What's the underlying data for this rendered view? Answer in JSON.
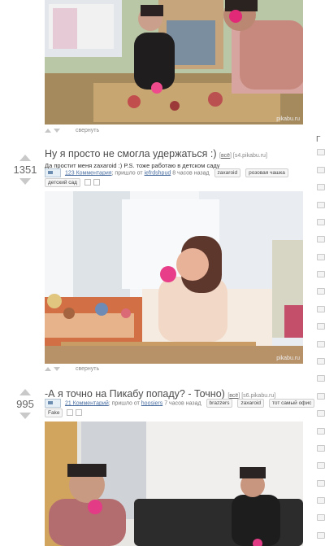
{
  "watermark": "pikabu.ru",
  "post_actions": {
    "collapse_label": "свернуть"
  },
  "sidebar_edge": {
    "letter": "Г"
  },
  "posts": [
    {
      "rating": "1351",
      "title": "Ну я просто не смогла удержаться :)",
      "source_prefix": "[",
      "source_link": "всё",
      "source_suffix": "] [s4.pikabu.ru]",
      "description": "Да простит меня zaxaroid :) P.S. тоже работаю в детском саду",
      "comments": "123 Комментария",
      "posted_prefix": "; пришло от",
      "author": "iefrdshpud",
      "time": "8 часов назад",
      "tags": [
        "zaxaroid",
        "розовая чашка",
        "детский сад"
      ]
    },
    {
      "rating": "995",
      "title": "-А я точно на Пикабу попаду? - Точно)",
      "source_prefix": "[",
      "source_link": "всё",
      "source_suffix": "] [s6.pikabu.ru]",
      "comments": "21 Комментарий",
      "posted_prefix": "; пришло от",
      "author": "hoosiers",
      "time": "7 часов назад",
      "tags": [
        "brazzers",
        "zaxaroid",
        "тот самый офис",
        "Fake"
      ]
    }
  ]
}
